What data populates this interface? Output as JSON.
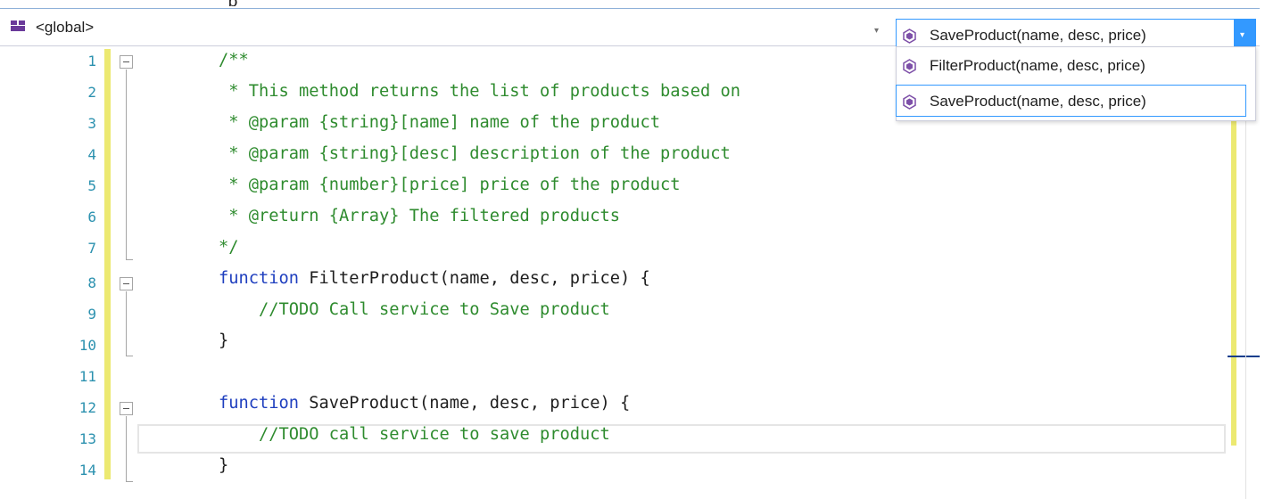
{
  "top_clip_text": "p",
  "navbar": {
    "scope_label": "<global>",
    "scope_arrow": "▾",
    "member_label": "SaveProduct(name, desc, price)",
    "member_arrow": "▾"
  },
  "dropdown": {
    "items": [
      {
        "label": "FilterProduct(name, desc, price)",
        "icon": "method-icon"
      },
      {
        "label": "SaveProduct(name, desc, price)",
        "icon": "method-icon",
        "selected": true
      }
    ]
  },
  "editor": {
    "lines": [
      {
        "no": "1",
        "text": "/**"
      },
      {
        "no": "2",
        "text": " * This method returns the list of products based on"
      },
      {
        "no": "3",
        "text": " * @param {string}[name] name of the product"
      },
      {
        "no": "4",
        "text": " * @param {string}[desc] description of the product"
      },
      {
        "no": "5",
        "text": " * @param {number}[price] price of the product"
      },
      {
        "no": "6",
        "text": " * @return {Array} The filtered products"
      },
      {
        "no": "7",
        "text": "*/"
      },
      {
        "no": "8",
        "keyword": "function",
        "text": " FilterProduct(name, desc, price) {"
      },
      {
        "no": "9",
        "text": "    //TODO Call service to Save product"
      },
      {
        "no": "10",
        "text": "}"
      },
      {
        "no": "11",
        "text": ""
      },
      {
        "no": "12",
        "keyword": "function",
        "text": " SaveProduct(name, desc, price) {"
      },
      {
        "no": "13",
        "text": "    //TODO call service to save product"
      },
      {
        "no": "14",
        "text": "}"
      }
    ]
  },
  "colors": {
    "accent": "#3399ff",
    "comment": "#2e8b2e",
    "keyword": "#1f3fbf",
    "line_number": "#2b91af",
    "change_bar": "#ece971"
  }
}
